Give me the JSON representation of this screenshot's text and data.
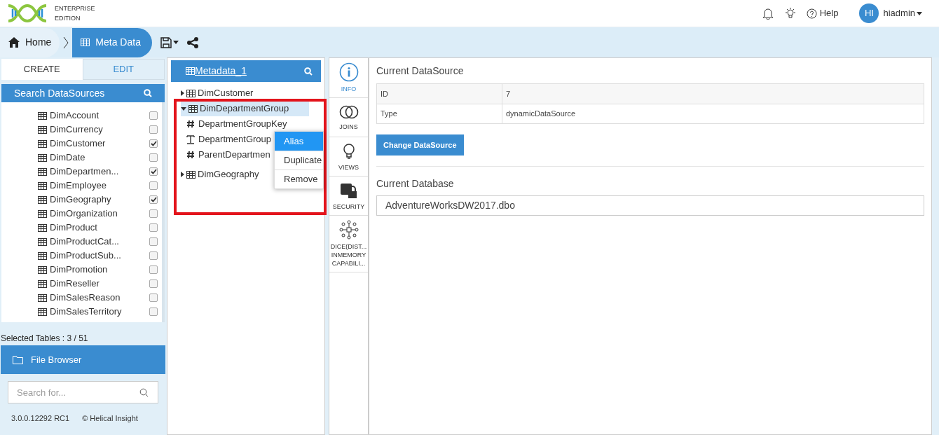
{
  "header": {
    "logo_text": [
      "ENTERPRISE",
      "EDITION"
    ],
    "help": "Help",
    "avatar": "HI",
    "user": "hiadmin"
  },
  "breadcrumb": [
    {
      "label": "Home",
      "selected": false
    },
    {
      "label": "Meta Data",
      "selected": true
    }
  ],
  "left_panel": {
    "tabs": [
      {
        "label": "CREATE",
        "selected": true
      },
      {
        "label": "EDIT",
        "selected": false
      }
    ],
    "search_title": "Search DataSources",
    "tables": [
      {
        "name": "DimAccount",
        "checked": false
      },
      {
        "name": "DimCurrency",
        "checked": false
      },
      {
        "name": "DimCustomer",
        "checked": true
      },
      {
        "name": "DimDate",
        "checked": false
      },
      {
        "name": "DimDepartmen...",
        "checked": true
      },
      {
        "name": "DimEmployee",
        "checked": false
      },
      {
        "name": "DimGeography",
        "checked": true
      },
      {
        "name": "DimOrganization",
        "checked": false
      },
      {
        "name": "DimProduct",
        "checked": false
      },
      {
        "name": "DimProductCat...",
        "checked": false
      },
      {
        "name": "DimProductSub...",
        "checked": false
      },
      {
        "name": "DimPromotion",
        "checked": false
      },
      {
        "name": "DimReseller",
        "checked": false
      },
      {
        "name": "DimSalesReason",
        "checked": false
      },
      {
        "name": "DimSalesTerritory",
        "checked": false
      }
    ],
    "selected_count": "Selected Tables : 3 / 51",
    "file_browser": "File Browser",
    "search": {
      "placeholder": "Search for..."
    },
    "version": "3.0.0.12292 RC1",
    "copyright": "© Helical Insight"
  },
  "metadata": {
    "title": "Metadata_1",
    "tree": [
      {
        "label": "DimCustomer",
        "kind": "table",
        "expanded": false,
        "selected": false
      },
      {
        "label": "DimDepartmentGroup",
        "kind": "table",
        "expanded": true,
        "selected": true,
        "children": [
          {
            "label": "DepartmentGroupKey",
            "kind": "number"
          },
          {
            "label": "DepartmentGroup",
            "kind": "text"
          },
          {
            "label": "ParentDepartmen",
            "kind": "number"
          }
        ]
      },
      {
        "label": "DimGeography",
        "kind": "table",
        "expanded": false,
        "selected": false
      }
    ]
  },
  "context_menu": [
    {
      "label": "Alias",
      "selected": true
    },
    {
      "label": "Duplicate",
      "selected": false
    },
    {
      "label": "Remove",
      "selected": false
    }
  ],
  "side_tabs": [
    {
      "label": "INFO",
      "kind": "info",
      "selected": true
    },
    {
      "label": "JOINS",
      "kind": "joins",
      "selected": false
    },
    {
      "label": "VIEWS",
      "kind": "views",
      "selected": false
    },
    {
      "label": "SECURITY",
      "kind": "security",
      "selected": false
    },
    {
      "label": "DICE(DIST... INMEMORY CAPABILI...",
      "kind": "dice",
      "selected": false
    }
  ],
  "info": {
    "datasource_title": "Current DataSource",
    "rows": [
      [
        "ID",
        "7"
      ],
      [
        "Type",
        "dynamicDataSource"
      ]
    ],
    "change_button": "Change DataSource",
    "database_title": "Current Database",
    "database": "AdventureWorksDW2017.dbo"
  }
}
